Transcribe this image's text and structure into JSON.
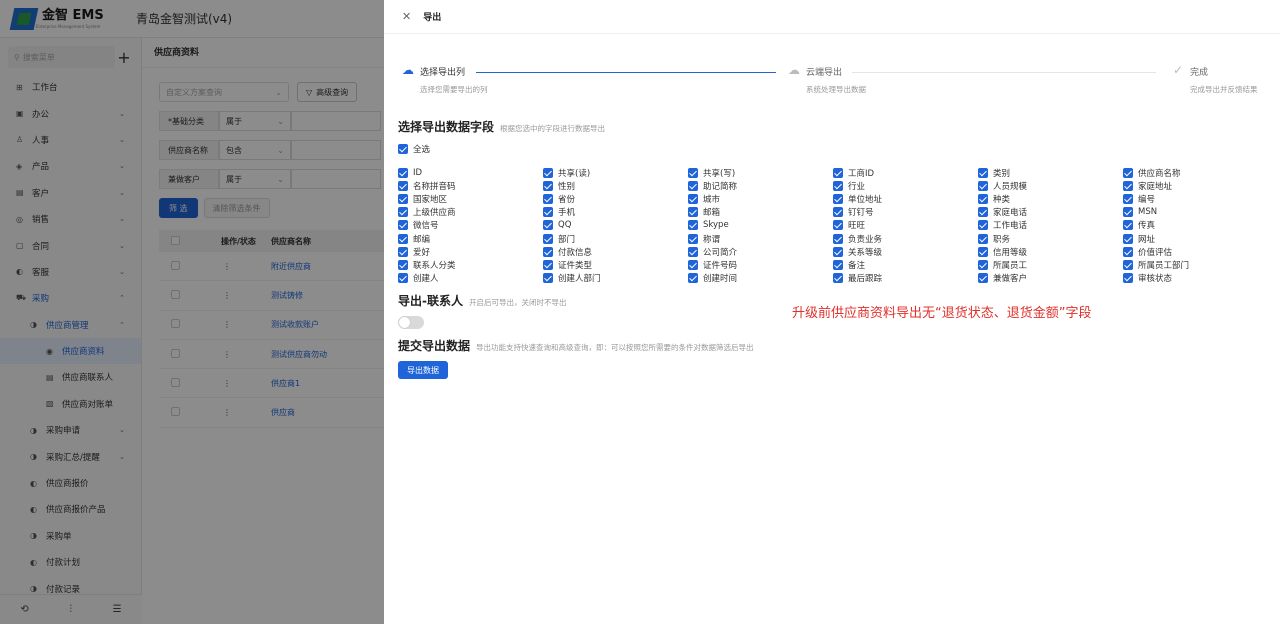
{
  "app": {
    "logo_text": "金智 EMS",
    "logo_sub": "Enterprise Management System",
    "title": "青岛金智测试(v4)"
  },
  "sidebar": {
    "search_placeholder": "搜索菜单",
    "items": [
      {
        "label": "工作台",
        "icon": "desk-icon",
        "level": 0,
        "chevron": false
      },
      {
        "label": "办公",
        "icon": "office-icon",
        "level": 0,
        "chevron": true
      },
      {
        "label": "人事",
        "icon": "person-icon",
        "level": 0,
        "chevron": true
      },
      {
        "label": "产品",
        "icon": "product-icon",
        "level": 0,
        "chevron": true
      },
      {
        "label": "客户",
        "icon": "customer-icon",
        "level": 0,
        "chevron": true
      },
      {
        "label": "销售",
        "icon": "sales-icon",
        "level": 0,
        "chevron": true
      },
      {
        "label": "合同",
        "icon": "contract-icon",
        "level": 0,
        "chevron": true
      },
      {
        "label": "客服",
        "icon": "service-icon",
        "level": 0,
        "chevron": true
      },
      {
        "label": "采购",
        "icon": "purchase-icon",
        "level": 0,
        "chevron": true,
        "state": "blue"
      },
      {
        "label": "供应商管理",
        "icon": "supplier-icon",
        "level": 1,
        "chevron": true,
        "state": "blue"
      },
      {
        "label": "供应商资料",
        "icon": "doc-icon",
        "level": 2,
        "chevron": false,
        "state": "active"
      },
      {
        "label": "供应商联系人",
        "icon": "contact-icon",
        "level": 2,
        "chevron": false
      },
      {
        "label": "供应商对账单",
        "icon": "statement-icon",
        "level": 2,
        "chevron": false
      },
      {
        "label": "采购申请",
        "icon": "request-icon",
        "level": 1,
        "chevron": true
      },
      {
        "label": "采购汇总/提醒",
        "icon": "summary-icon",
        "level": 1,
        "chevron": true
      },
      {
        "label": "供应商报价",
        "icon": "quote-icon",
        "level": 1,
        "chevron": false
      },
      {
        "label": "供应商报价产品",
        "icon": "quote-product-icon",
        "level": 1,
        "chevron": false
      },
      {
        "label": "采购单",
        "icon": "order-icon",
        "level": 1,
        "chevron": false
      },
      {
        "label": "付款计划",
        "icon": "payment-icon",
        "level": 1,
        "chevron": false
      },
      {
        "label": "付款记录",
        "icon": "record-icon",
        "level": 1,
        "chevron": false
      }
    ]
  },
  "main": {
    "title": "供应商资料",
    "custom_query_placeholder": "自定义方案查询",
    "advanced_query": "高级查询",
    "filters": [
      {
        "label": "*基础分类",
        "op": "属于"
      },
      {
        "label": "供应商名称",
        "op": "包含"
      },
      {
        "label": "兼做客户",
        "op": "属于"
      }
    ],
    "filter_button": "筛 选",
    "clear_button": "清除筛选条件",
    "table": {
      "headers": [
        "操作/状态",
        "供应商名称"
      ],
      "rows": [
        "附近供应商",
        "测试铸修",
        "测试收款账户",
        "测试供应商勿动",
        "供应商1",
        "供应商"
      ]
    }
  },
  "drawer": {
    "title": "导出",
    "steps": [
      {
        "title": "选择导出列",
        "desc": "选择您需要导出的列",
        "icon": "cloud-upload-icon"
      },
      {
        "title": "云端导出",
        "desc": "系统处理导出数据",
        "icon": "cloud-icon"
      },
      {
        "title": "完成",
        "desc": "完成导出并反馈结果",
        "icon": "check-circle-icon"
      }
    ],
    "select_section": {
      "title": "选择导出数据字段",
      "hint": "根据您选中的字段进行数据导出"
    },
    "select_all": "全选",
    "fields": [
      "ID",
      "共享(读)",
      "共享(写)",
      "工商ID",
      "类别",
      "供应商名称",
      "名称拼音码",
      "性别",
      "助记简称",
      "行业",
      "人员规模",
      "家庭地址",
      "国家地区",
      "省份",
      "城市",
      "单位地址",
      "种类",
      "编号",
      "上级供应商",
      "手机",
      "邮箱",
      "钉钉号",
      "家庭电话",
      "MSN",
      "微信号",
      "QQ",
      "Skype",
      "旺旺",
      "工作电话",
      "传真",
      "邮编",
      "部门",
      "称谓",
      "负责业务",
      "职务",
      "网址",
      "爱好",
      "付款信息",
      "公司简介",
      "关系等级",
      "信用等级",
      "价值评估",
      "联系人分类",
      "证件类型",
      "证件号码",
      "备注",
      "所属员工",
      "所属员工部门",
      "创建人",
      "创建人部门",
      "创建时间",
      "最后跟踪",
      "兼做客户",
      "审核状态"
    ],
    "contact_section": {
      "title": "导出-联系人",
      "hint": "开启后可导出，关闭时不导出"
    },
    "submit_section": {
      "title": "提交导出数据",
      "hint": "导出功能支持快速查询和高级查询，即：可以按照您所需要的条件对数据筛选后导出"
    },
    "export_button": "导出数据",
    "annotation": "升级前供应商资料导出无“退货状态、退货金额”字段"
  },
  "colors": {
    "primary": "#1f64d8",
    "annotation": "#e0302b"
  }
}
